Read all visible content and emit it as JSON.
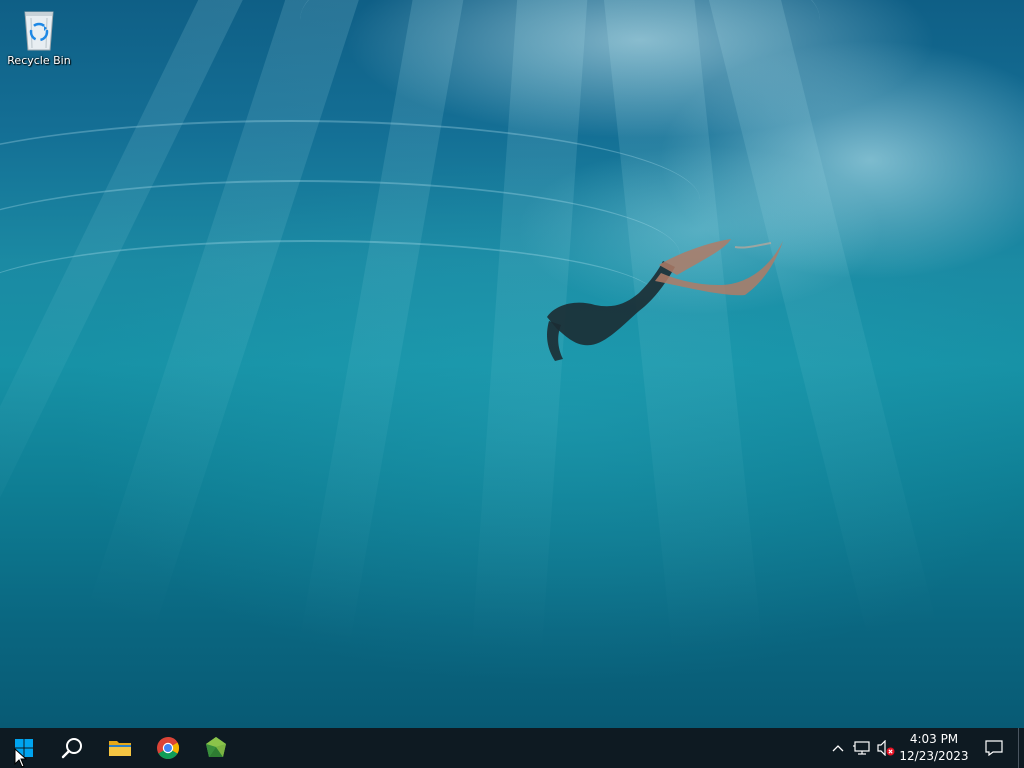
{
  "desktop": {
    "icons": [
      {
        "label": "Recycle Bin",
        "icon": "recycle-bin-icon"
      }
    ]
  },
  "taskbar": {
    "start": {
      "icon": "windows-logo-icon"
    },
    "search": {
      "icon": "search-icon"
    },
    "pinned": [
      {
        "name": "File Explorer",
        "icon": "folder-icon"
      },
      {
        "name": "Google Chrome",
        "icon": "chrome-icon"
      },
      {
        "name": "Green gem app",
        "icon": "green-gem-icon"
      }
    ],
    "tray": {
      "overflow_icon": "chevron-up-icon",
      "network_icon": "network-icon",
      "volume_icon": "volume-muted-icon",
      "time": "4:03 PM",
      "date": "12/23/2023",
      "notification_icon": "action-center-icon"
    }
  },
  "colors": {
    "taskbar": "#0e1a22",
    "water_top": "#0f5f86",
    "water_bottom": "#085a74",
    "windows_blue": "#00a4ef"
  }
}
